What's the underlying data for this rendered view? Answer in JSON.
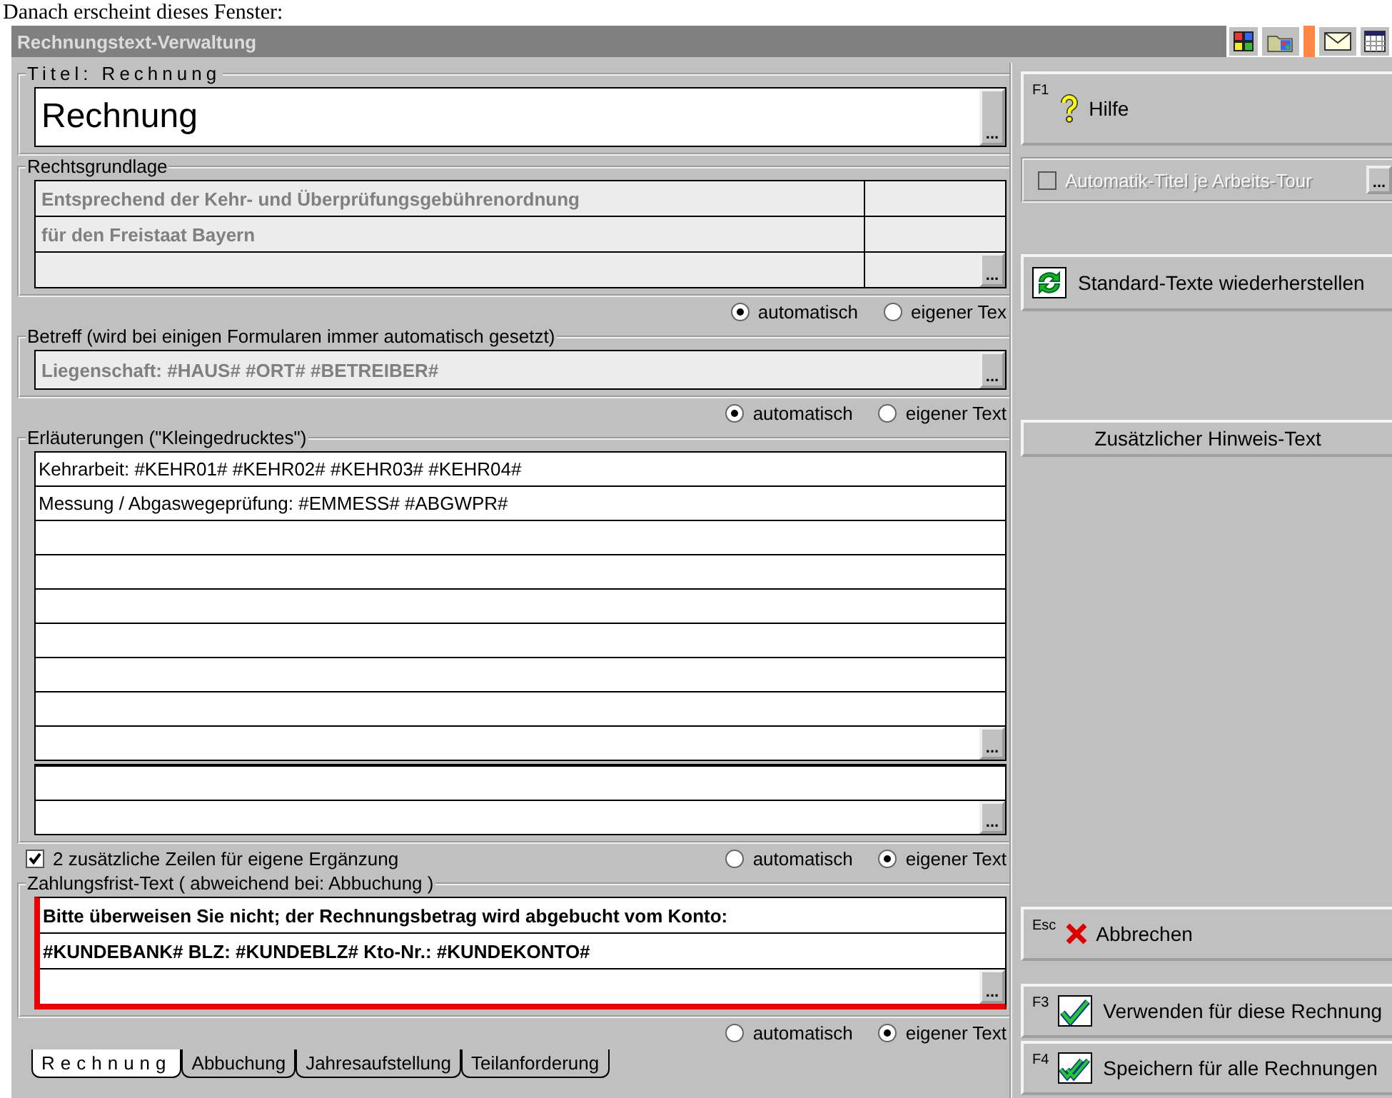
{
  "caption": "Danach erscheint dieses Fenster:",
  "window": {
    "title": "Rechnungstext-Verwaltung"
  },
  "titel": {
    "label": "Titel: Rechnung",
    "value": "Rechnung",
    "more_button": "..."
  },
  "rechtsgrundlage": {
    "label": "Rechtsgrundlage",
    "disabled": true,
    "more_button": "...",
    "lines": [
      "Entsprechend der Kehr- und Überprüfungsgebührenordnung",
      "für den Freistaat Bayern"
    ],
    "options": [
      {
        "label": "automatisch",
        "selected": true
      },
      {
        "label": "eigener Tex",
        "selected": false
      }
    ]
  },
  "betreff": {
    "label": "Betreff  (wird bei einigen Formularen immer automatisch gesetzt)",
    "disabled": true,
    "value": "Liegenschaft: #HAUS#  #ORT#  #BETREIBER#",
    "more_button": "...",
    "options": [
      {
        "label": "automatisch",
        "selected": true
      },
      {
        "label": "eigener Text",
        "selected": false
      }
    ]
  },
  "erlaeuterungen": {
    "label": "Erläuterungen (\"Kleingedrucktes\")",
    "more_button": "...",
    "extra_more_button": "...",
    "lines": [
      "Kehrarbeit: #KEHR01# #KEHR02# #KEHR03# #KEHR04#",
      "Messung / Abgaswegeprüfung: #EMMESS#  #ABGWPR#"
    ],
    "extra_lines": {
      "label": "2 zusätzliche Zeilen für eigene Ergänzung",
      "checked": true
    },
    "options": [
      {
        "label": "automatisch",
        "selected": false
      },
      {
        "label": "eigener Text",
        "selected": true
      }
    ]
  },
  "zahlungsfrist": {
    "label": "Zahlungsfrist-Text  ( abweichend bei: Abbuchung )",
    "highlighted": true,
    "more_button": "...",
    "lines": [
      "Bitte überweisen Sie nicht; der Rechnungsbetrag wird abgebucht vom Konto:",
      "#KUNDEBANK#    BLZ: #KUNDEBLZ#    Kto-Nr.: #KUNDEKONTO#"
    ],
    "options": [
      {
        "label": "automatisch",
        "selected": false
      },
      {
        "label": "eigener Text",
        "selected": true
      }
    ]
  },
  "tabs": [
    {
      "label": "Rechnung",
      "selected": true
    },
    {
      "label": "Abbuchung",
      "selected": false
    },
    {
      "label": "Jahresaufstellung",
      "selected": false
    },
    {
      "label": "Teilanforderung",
      "selected": false
    }
  ],
  "sidebar": {
    "help": {
      "key": "F1",
      "label": "Hilfe"
    },
    "automatik": {
      "label": "Automatik-Titel je Arbeits-Tour",
      "checked": false,
      "disabled": true,
      "more_button": "..."
    },
    "restore": {
      "label": "Standard-Texte wiederherstellen"
    },
    "hint": {
      "label": "Zusätzlicher Hinweis-Text"
    },
    "cancel": {
      "key": "Esc",
      "label": "Abbrechen"
    },
    "actions": [
      {
        "key": "F3",
        "label": "Verwenden für diese Rechnung",
        "kind": "single"
      },
      {
        "key": "F4",
        "label": "Speichern für alle Rechnungen",
        "kind": "double"
      }
    ]
  }
}
